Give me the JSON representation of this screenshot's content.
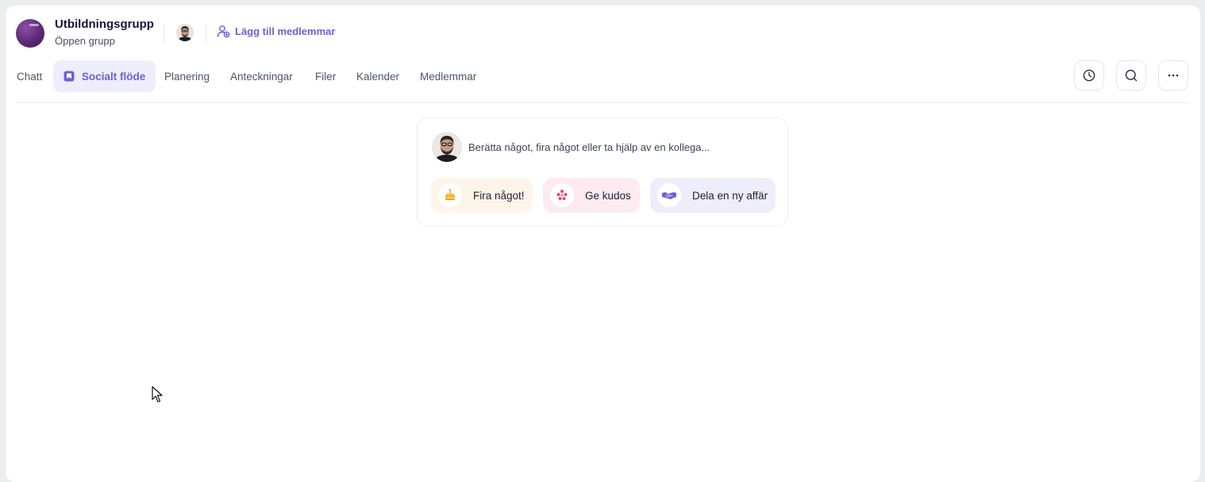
{
  "group": {
    "name": "Utbildningsgrupp",
    "type": "Öppen grupp",
    "add_members_label": "Lägg till medlemmar"
  },
  "tabs": [
    {
      "label": "Chatt",
      "active": false
    },
    {
      "label": "Socialt flöde",
      "active": true
    },
    {
      "label": "Planering",
      "active": false
    },
    {
      "label": "Anteckningar",
      "active": false
    },
    {
      "label": "Filer",
      "active": false
    },
    {
      "label": "Kalender",
      "active": false
    },
    {
      "label": "Medlemmar",
      "active": false
    }
  ],
  "toolbar": {
    "icons": [
      "clock-icon",
      "search-icon",
      "more-icon"
    ]
  },
  "composer": {
    "placeholder": "Berätta något, fira något eller ta hjälp av en kollega...",
    "actions": [
      {
        "label": "Fira något!",
        "icon": "cake-icon",
        "color": "#fdf5e8"
      },
      {
        "label": "Ge kudos",
        "icon": "kudos-icon",
        "color": "#fdebf1"
      },
      {
        "label": "Dela en ny affär",
        "icon": "handshake-icon",
        "color": "#eeeefb"
      }
    ]
  },
  "colors": {
    "accent": "#6a62d6",
    "active_tab_bg": "#eeedfb"
  }
}
